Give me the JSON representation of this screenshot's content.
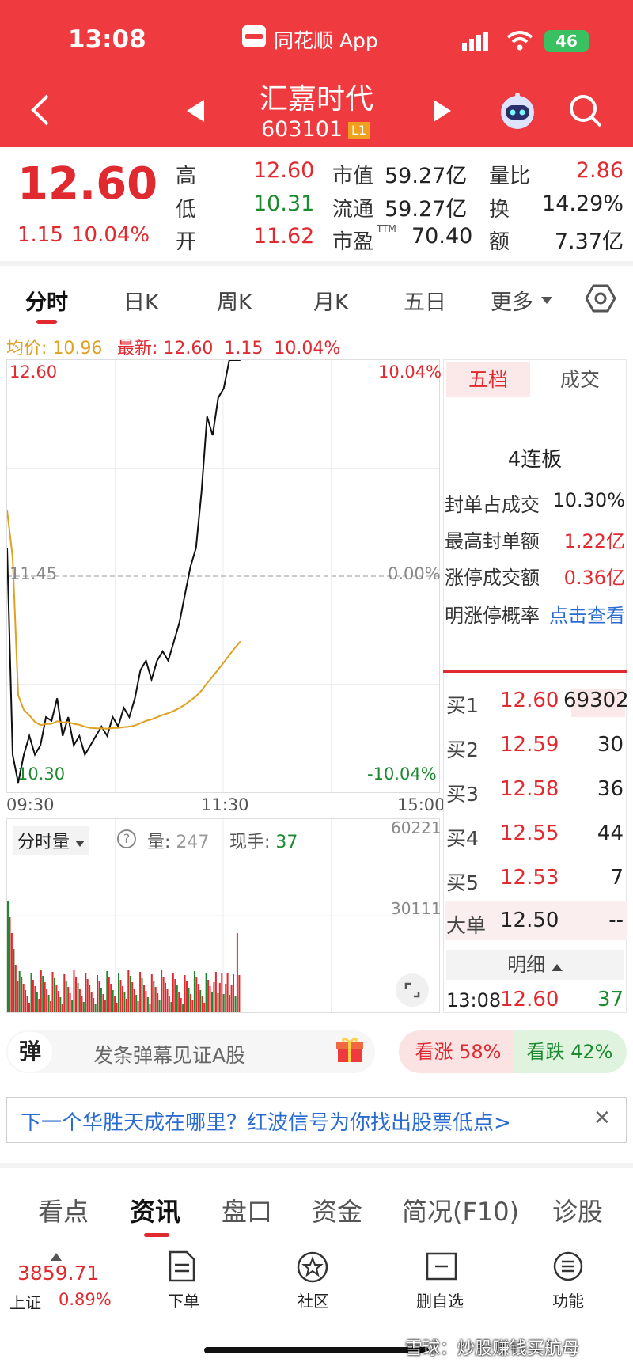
{
  "status": {
    "time": "13:08",
    "app": "同花顺 App",
    "signal": "46"
  },
  "header": {
    "name": "汇嘉时代",
    "code": "603101",
    "level": "L1"
  },
  "quote": {
    "price": "12.60",
    "change": "1.15",
    "pct": "10.04%",
    "high_l": "高",
    "high": "12.60",
    "low_l": "低",
    "low": "10.31",
    "open_l": "开",
    "open": "11.62",
    "mcap_l": "市值",
    "mcap": "59.27亿",
    "float_l": "流通",
    "float": "59.27亿",
    "pe_l": "市盈",
    "pe_sup": "TTM",
    "pe": "70.40",
    "vr_l": "量比",
    "vr": "2.86",
    "turn_l": "换",
    "turn": "14.29%",
    "amt_l": "额",
    "amt": "7.37亿"
  },
  "tabs": [
    "分时",
    "日K",
    "周K",
    "月K",
    "五日",
    "更多"
  ],
  "chart_info": {
    "avg_l": "均价:",
    "avg": "10.96",
    "last_l": "最新:",
    "last": "12.60",
    "chg": "1.15",
    "pct": "10.04%"
  },
  "chart": {
    "top_price": "12.60",
    "top_pct": "10.04%",
    "mid_price": "11.45",
    "mid_pct": "0.00%",
    "bot_price": "10.30",
    "bot_pct": "-10.04%",
    "t0": "09:30",
    "t1": "11:30",
    "t2": "15:00",
    "line_color": "#111111",
    "avg_color": "#e0a020",
    "price_series": [
      11.6,
      10.5,
      10.35,
      10.5,
      10.6,
      10.5,
      10.55,
      10.7,
      10.68,
      10.8,
      10.6,
      10.7,
      10.55,
      10.6,
      10.5,
      10.55,
      10.6,
      10.65,
      10.6,
      10.7,
      10.65,
      10.75,
      10.7,
      10.8,
      10.95,
      11.0,
      10.9,
      11.0,
      11.05,
      11.0,
      11.1,
      11.2,
      11.35,
      11.5,
      11.6,
      11.9,
      12.3,
      12.2,
      12.4,
      12.45,
      12.6,
      12.6,
      12.6
    ]
  },
  "volume": {
    "label": "分时量",
    "vol_l": "量:",
    "vol": "247",
    "hand_l": "现手:",
    "hand": "37",
    "max": "60221",
    "mid": "30111"
  },
  "side": {
    "tab1": "五档",
    "tab2": "成交",
    "streak": "4连板",
    "rows": [
      {
        "label": "封单占成交",
        "value": "10.30%"
      },
      {
        "label": "最高封单额",
        "value": "1.22亿"
      },
      {
        "label": "涨停成交额",
        "value": "0.36亿"
      },
      {
        "label": "明涨停概率",
        "value": "点击查看"
      }
    ],
    "bids": [
      {
        "label": "买1",
        "price": "12.60",
        "vol": "69302"
      },
      {
        "label": "买2",
        "price": "12.59",
        "vol": "30"
      },
      {
        "label": "买3",
        "price": "12.58",
        "vol": "36"
      },
      {
        "label": "买4",
        "price": "12.55",
        "vol": "44"
      },
      {
        "label": "买5",
        "price": "12.53",
        "vol": "7"
      }
    ],
    "big_l": "大单",
    "big_p": "12.50",
    "big_v": "--",
    "detail_l": "明细",
    "detail_time": "13:08",
    "detail_price": "12.60",
    "detail_vol": "37"
  },
  "danmu": {
    "icon": "弹",
    "placeholder": "发条弹幕见证A股",
    "up": "看涨 58%",
    "down": "看跌 42%"
  },
  "banner": {
    "text": "下一个华胜天成在哪里？红波信号为你找出股票低点>"
  },
  "bottom_tabs": [
    "看点",
    "资讯",
    "盘口",
    "资金",
    "简况(F10)",
    "诊股"
  ],
  "nav": {
    "index_val": "3859.71",
    "index_name": "上证",
    "index_pct": "0.89%",
    "items": [
      "下单",
      "社区",
      "删自选",
      "功能"
    ]
  },
  "watermark": "雪球：炒股赚钱买航母"
}
